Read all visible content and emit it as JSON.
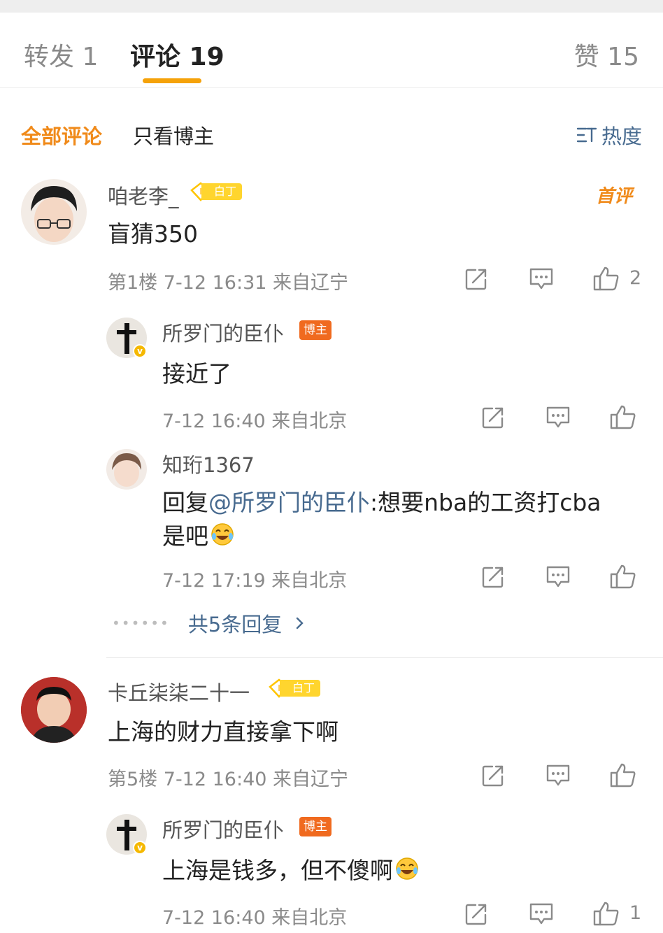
{
  "tabs": {
    "repost": "转发 1",
    "comments": "评论 19",
    "likes": "赞 15"
  },
  "filters": {
    "all": "全部评论",
    "author_only": "只看博主",
    "sort": "热度"
  },
  "colors": {
    "accent_orange": "#f08a1a",
    "tab_underline": "#f5a20a",
    "link_blue": "#476a8f",
    "badge_yellow": "#ffd52e",
    "author_badge": "#f06a1f"
  },
  "comments": [
    {
      "user": "咱老李_",
      "badge": "白丁",
      "first_tag": "首评",
      "text": "盲猜350",
      "meta": "第1楼 7-12 16:31 来自辽宁",
      "like_count": "2",
      "replies": [
        {
          "user": "所罗门的臣仆",
          "badge": "博主",
          "text": "接近了",
          "meta": "7-12 16:40 来自北京"
        },
        {
          "user": "知珩1367",
          "text_prefix": "回复",
          "mention": "@所罗门的臣仆",
          "text_line1": ":想要nba的工资打cba",
          "text_line2": "是吧",
          "meta": "7-12 17:19 来自北京"
        }
      ],
      "more_replies": "共5条回复"
    },
    {
      "user": "卡丘柒柒二十一",
      "badge": "白丁",
      "text": "上海的财力直接拿下啊",
      "meta": "第5楼 7-12 16:40 来自辽宁",
      "replies": [
        {
          "user": "所罗门的臣仆",
          "badge": "博主",
          "text": "上海是钱多，但不傻啊",
          "meta": "7-12 16:40 来自北京",
          "like_count": "1"
        }
      ]
    }
  ]
}
